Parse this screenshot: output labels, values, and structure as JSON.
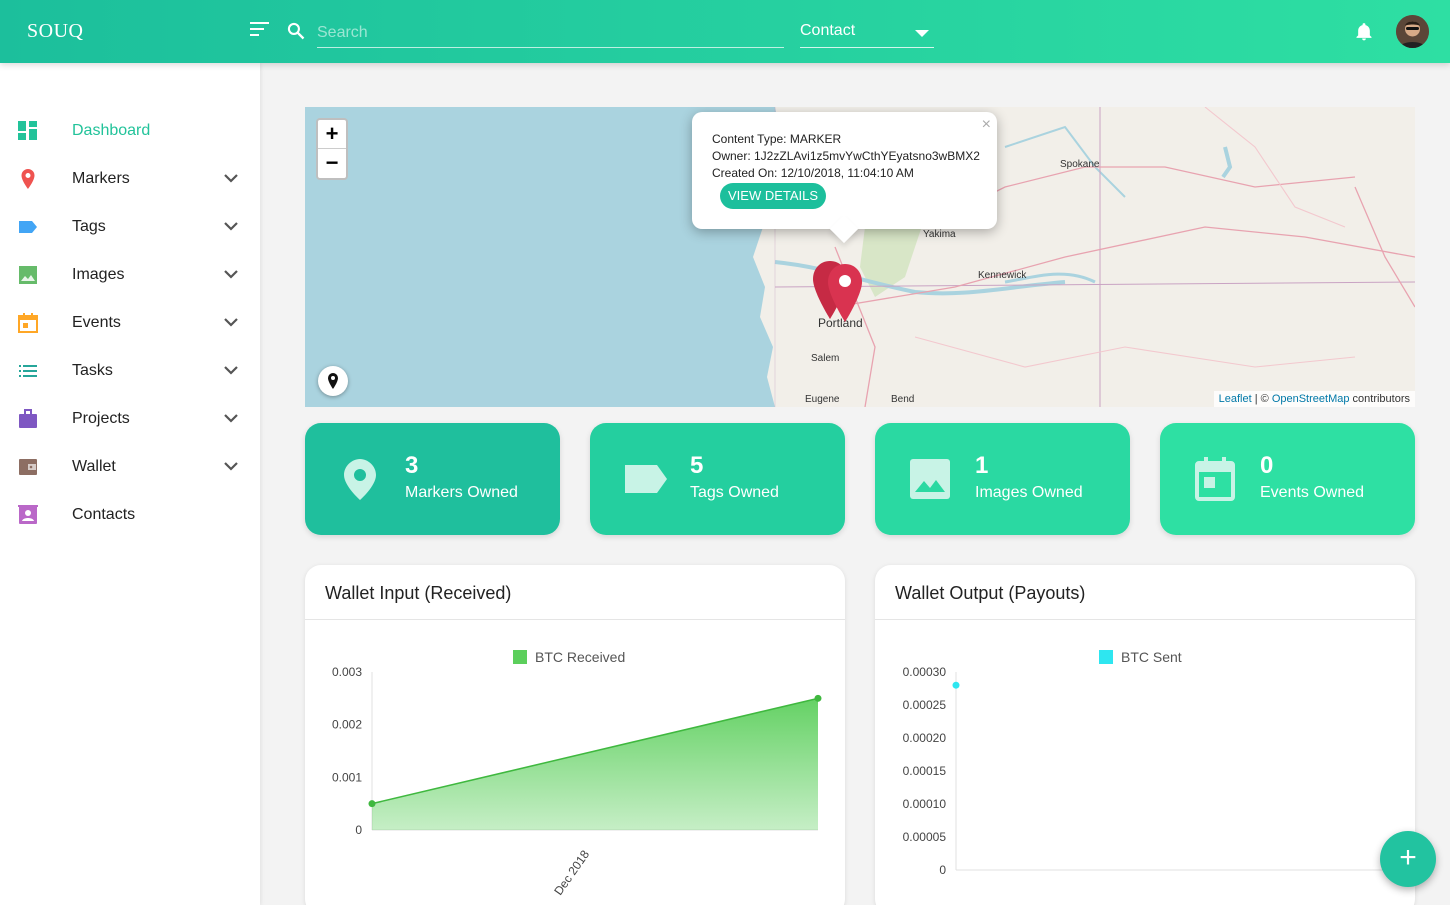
{
  "header": {
    "brand": "SOUQ",
    "search_placeholder": "Search",
    "search_value": "",
    "category_select": "Contact"
  },
  "sidebar": {
    "items": [
      {
        "label": "Dashboard",
        "icon": "dashboard-icon",
        "color": "#22c39a",
        "active": true,
        "expandable": false
      },
      {
        "label": "Markers",
        "icon": "map-pin-icon",
        "color": "#ef5350",
        "expandable": true
      },
      {
        "label": "Tags",
        "icon": "tag-icon",
        "color": "#42a5f5",
        "expandable": true
      },
      {
        "label": "Images",
        "icon": "image-icon",
        "color": "#66bb6a",
        "expandable": true
      },
      {
        "label": "Events",
        "icon": "calendar-icon",
        "color": "#ffa726",
        "expandable": true
      },
      {
        "label": "Tasks",
        "icon": "list-icon",
        "color": "#26a69a",
        "expandable": true
      },
      {
        "label": "Projects",
        "icon": "briefcase-icon",
        "color": "#7e57c2",
        "expandable": true
      },
      {
        "label": "Wallet",
        "icon": "wallet-icon",
        "color": "#8d6e63",
        "expandable": true
      },
      {
        "label": "Contacts",
        "icon": "contact-card-icon",
        "color": "#ba68c8",
        "expandable": false
      }
    ]
  },
  "map": {
    "zoom_in": "+",
    "zoom_out": "−",
    "popup": {
      "content_type": "Content Type: MARKER",
      "owner": "Owner: 1J2zZLAvi1z5mvYwCthYEyatsno3wBMX2",
      "created": "Created On: 12/10/2018, 11:04:10 AM",
      "button": "VIEW DETAILS",
      "close": "×"
    },
    "place_labels": [
      "Spokane",
      "Yakima",
      "Kennewick",
      "Portland",
      "Salem",
      "Eugene",
      "Bend"
    ],
    "attribution": {
      "leaflet": "Leaflet",
      "sep": " | © ",
      "osm": "OpenStreetMap",
      "suffix": " contributors"
    }
  },
  "stats": [
    {
      "value": "3",
      "label": "Markers Owned",
      "icon": "map-pin-icon",
      "color": "#1fbf9d"
    },
    {
      "value": "5",
      "label": "Tags Owned",
      "icon": "tag-icon",
      "color": "#24cf9f"
    },
    {
      "value": "1",
      "label": "Images Owned",
      "icon": "image-icon",
      "color": "#2ad9a2"
    },
    {
      "value": "0",
      "label": "Events Owned",
      "icon": "calendar-icon",
      "color": "#2ee0a3"
    }
  ],
  "cards": {
    "input_title": "Wallet Input (Received)",
    "output_title": "Wallet Output (Payouts)"
  },
  "chart_data": [
    {
      "type": "area",
      "title": "Wallet Input (Received)",
      "series": [
        {
          "name": "BTC Received",
          "color": "#5ccf5c",
          "points": [
            [
              0,
              0.0005
            ],
            [
              1,
              0.0025
            ]
          ]
        }
      ],
      "x_tick_labels": [
        "Dec 2018"
      ],
      "yticks": [
        "0.003",
        "0.002",
        "0.001",
        "0"
      ],
      "ylim": [
        0,
        0.003
      ],
      "legend": "top"
    },
    {
      "type": "line",
      "title": "Wallet Output (Payouts)",
      "series": [
        {
          "name": "BTC Sent",
          "color": "#2ee6f0",
          "points": [
            [
              0,
              0.00028
            ]
          ]
        }
      ],
      "yticks": [
        "0.00030",
        "0.00025",
        "0.00020",
        "0.00015",
        "0.00010",
        "0.00005",
        "0"
      ],
      "ylim": [
        0,
        0.0003
      ],
      "legend": "top"
    }
  ],
  "fab": "+"
}
